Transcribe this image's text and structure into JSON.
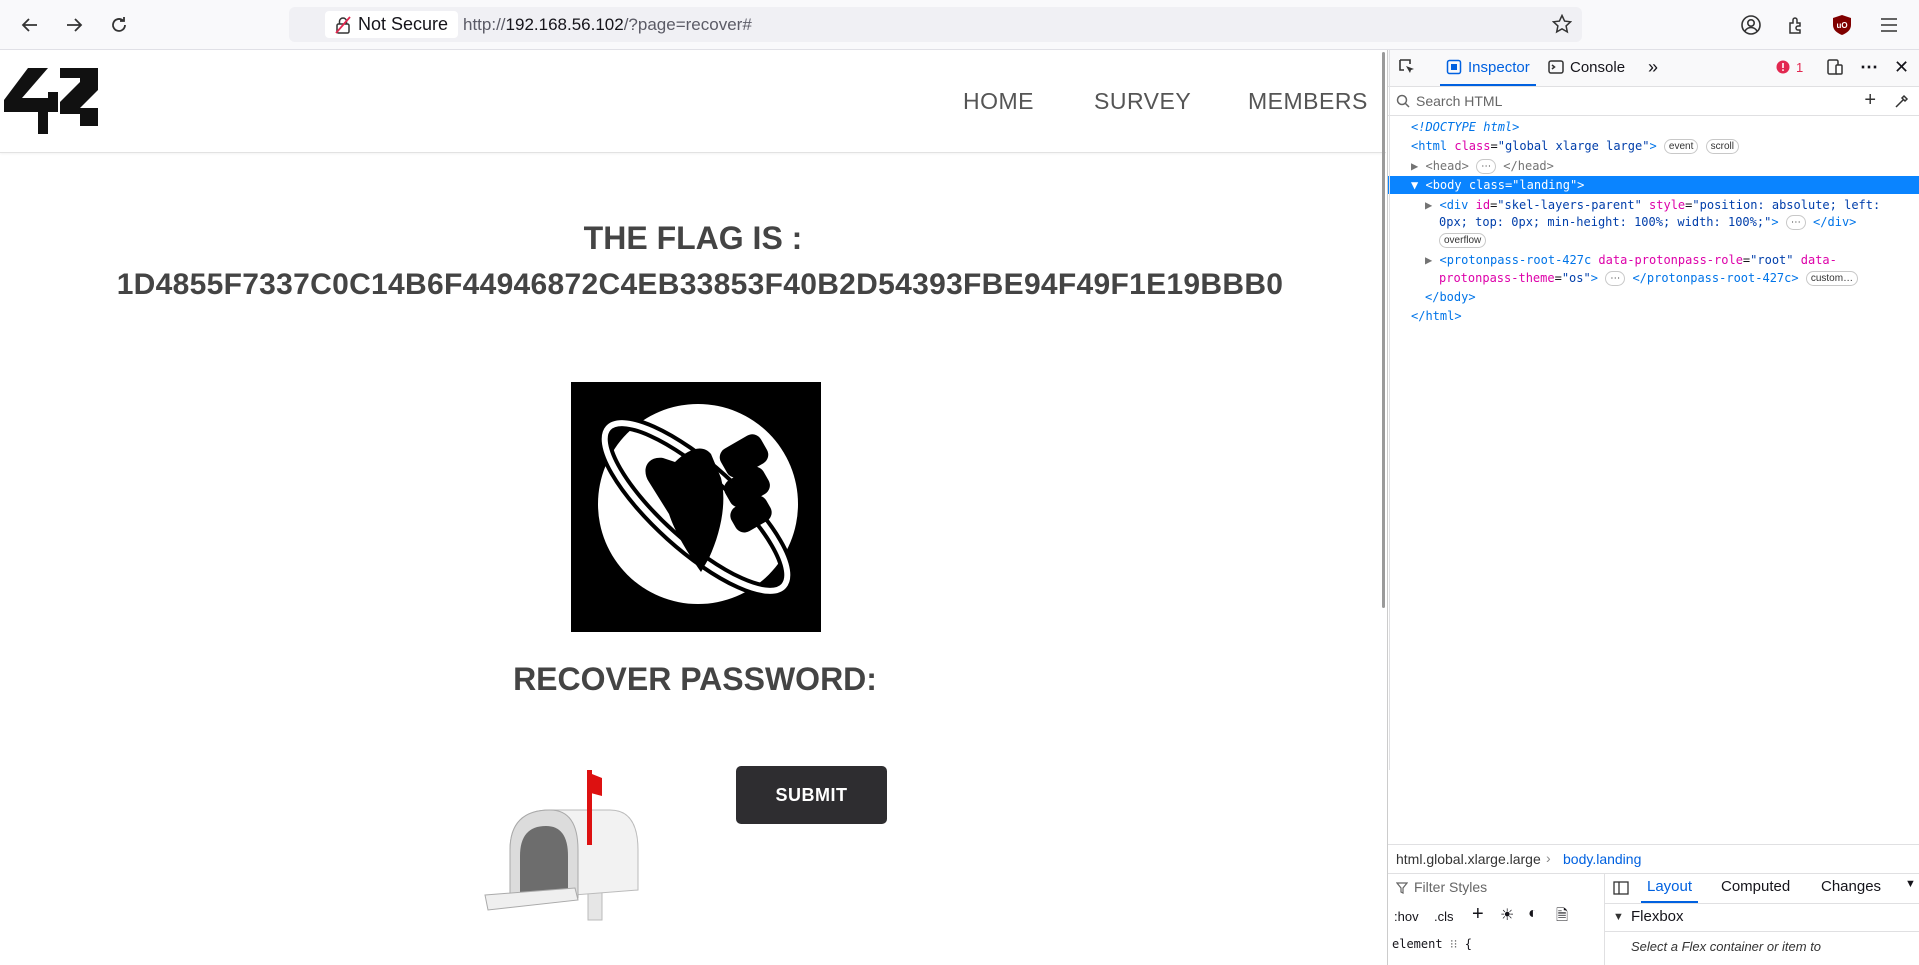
{
  "browser": {
    "security_label": "Not Secure",
    "url_prefix": "http://",
    "url_host": "192.168.56.102",
    "url_path": "/?page=recover#"
  },
  "site": {
    "logo_text": "42",
    "nav": [
      "HOME",
      "SURVEY",
      "MEMBERS"
    ],
    "flag_title": "THE FLAG IS :",
    "flag_value": "1D4855F7337C0C14B6F44946872C4EB33853F40B2D54393FBE94F49F1E19BBB0",
    "recover_title": "RECOVER PASSWORD:",
    "submit_label": "SUBMIT"
  },
  "devtools": {
    "tabs": {
      "inspector": "Inspector",
      "console": "Console"
    },
    "error_count": "1",
    "search_placeholder": "Search HTML",
    "tree": {
      "doctype": "<!DOCTYPE html>",
      "html_open": "<html",
      "html_class_attr": "class",
      "html_class_val": "\"global xlarge large\"",
      "html_close_bracket": ">",
      "badge_event": "event",
      "badge_scroll": "scroll",
      "head": "<head>",
      "head_close": "</head>",
      "body_line": "<body class=\"landing\">",
      "div_open": "<div",
      "div_id_attr": "id",
      "div_id_val": "\"skel-layers-parent\"",
      "div_style_attr": "style",
      "div_style_val1": "\"position: absolute; left:",
      "div_style_val2": "0px; top: 0px; min-height: 100%; width: 100%;\"",
      "div_close": "</div>",
      "badge_overflow": "overflow",
      "pp_open": "<protonpass-root-427c",
      "pp_role_attr": "data-protonpass-role",
      "pp_role_val": "\"root\"",
      "pp_theme_attr1": "data-",
      "pp_theme_attr2": "protonpass-theme",
      "pp_theme_val": "\"os\"",
      "pp_close": "</protonpass-root-427c>",
      "badge_custom": "custom…",
      "body_close": "</body>",
      "html_close": "</html>"
    },
    "breadcrumbs": [
      "html.global.xlarge.large",
      "body.landing"
    ],
    "filter_placeholder": "Filter Styles",
    "rules_buttons": [
      ":hov",
      ".cls"
    ],
    "element_rule": "element",
    "element_brace": "{",
    "side_tabs": [
      "Layout",
      "Computed",
      "Changes"
    ],
    "flexbox_label": "Flexbox",
    "flexbox_hint": "Select a Flex container or item to"
  }
}
